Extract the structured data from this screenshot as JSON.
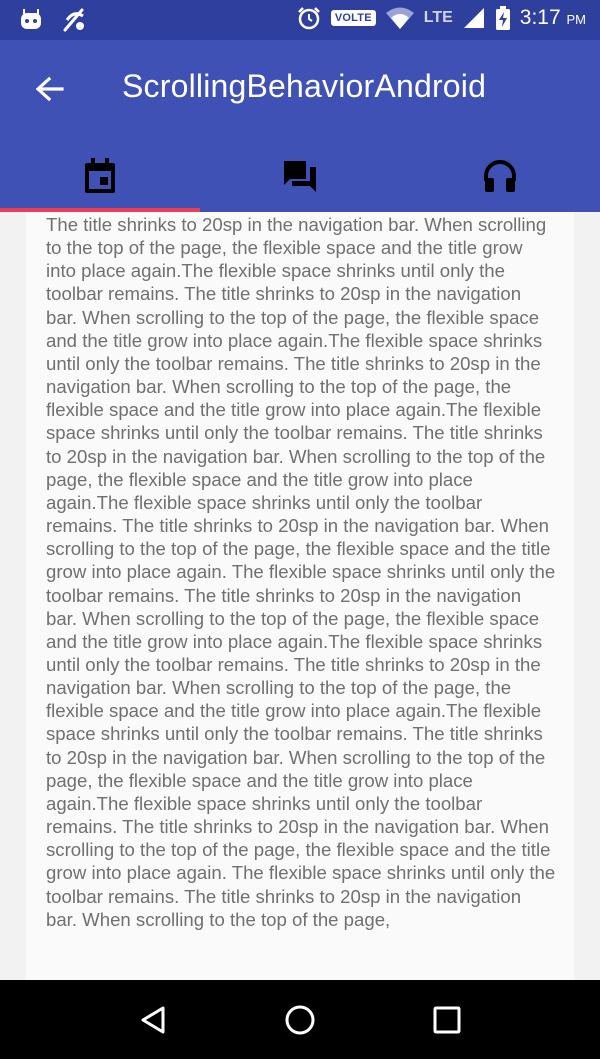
{
  "status_bar": {
    "volte_label": "VOLTE",
    "network_label": "LTE",
    "time": "3:17",
    "ampm": "PM"
  },
  "app_bar": {
    "title": "ScrollingBehaviorAndroid"
  },
  "tabs": [
    {
      "icon": "calendar-icon",
      "selected": true
    },
    {
      "icon": "forum-icon",
      "selected": false
    },
    {
      "icon": "headphones-icon",
      "selected": false
    }
  ],
  "colors": {
    "status_bar": "#2f3f9e",
    "app_bar": "#3f51b5",
    "tab_indicator": "#e83e5a",
    "body_text": "#707070"
  },
  "content": {
    "body": "The title shrinks to 20sp in the navigation bar. When scrolling to the top of the page, the flexible space and the title grow into place again.The flexible space shrinks until only the toolbar remains. The title shrinks to 20sp in the navigation bar. When scrolling to the top of the page, the flexible space and the title grow into place again.The flexible space shrinks until only the toolbar remains. The title shrinks to 20sp in the navigation bar. When scrolling to the top of the page, the flexible space and the title grow into place again.The flexible space shrinks until only the toolbar remains. The title shrinks to 20sp in the navigation bar. When scrolling to the top of the page, the flexible space and the title grow into place again.The flexible space shrinks until only the toolbar remains. The title shrinks to 20sp in the navigation bar. When scrolling to the top of the page, the flexible space and the title grow into place again. The flexible space shrinks until only the toolbar remains. The title shrinks to 20sp in the navigation bar. When scrolling to the top of the page, the flexible space and the title grow into place again.The flexible space shrinks until only the toolbar remains. The title shrinks to 20sp in the navigation bar. When scrolling to the top of the page, the flexible space and the title grow into place again.The flexible space shrinks until only the toolbar remains. The title shrinks to 20sp in the navigation bar. When scrolling to the top of the page, the flexible space and the title grow into place again.The flexible space shrinks until only the toolbar remains. The title shrinks to 20sp in the navigation bar. When scrolling to the top of the page, the flexible space and the title grow into place again. The flexible space shrinks until only the toolbar remains. The title shrinks to 20sp in the navigation bar. When scrolling to the top of the page,"
  },
  "nav_bar": {
    "buttons": [
      "back-triangle-icon",
      "home-circle-icon",
      "recents-square-icon"
    ]
  }
}
